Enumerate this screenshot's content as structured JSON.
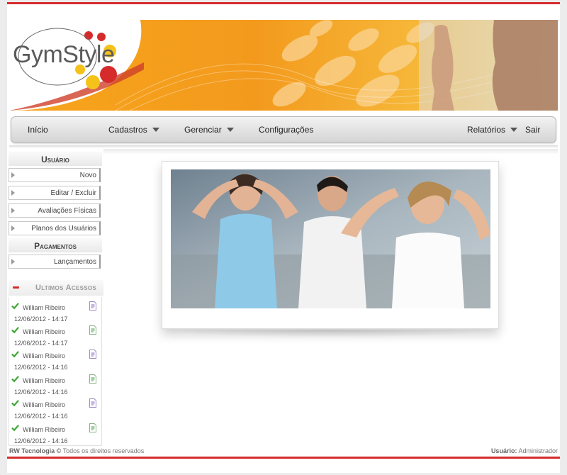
{
  "brand": {
    "logo_text": "GymStyle",
    "colors": {
      "accent_red": "#d62b2b",
      "orange": "#f39a1d",
      "yellow": "#f5c21a"
    }
  },
  "nav": {
    "home": "Início",
    "cadastros": "Cadastros",
    "gerenciar": "Gerenciar",
    "configuracoes": "Configurações",
    "relatorios": "Relatórios",
    "sair": "Sair"
  },
  "sidebar": {
    "usuario_header": "Usuário",
    "usuario_items": [
      {
        "label": "Novo"
      },
      {
        "label": "Editar / Excluir"
      },
      {
        "label": "Avaliações Físicas"
      },
      {
        "label": "Planos dos Usuários"
      }
    ],
    "pagamentos_header": "Pagamentos",
    "pagamentos_items": [
      {
        "label": "Lançamentos"
      }
    ]
  },
  "recent_access": {
    "title": "Ultimos Acessos",
    "entries": [
      {
        "name": "William Ribeiro",
        "time": "12/06/2012 - 14:17",
        "icon": "purple-doc-icon"
      },
      {
        "name": "William Ribeiro",
        "time": "12/06/2012 - 14:17",
        "icon": "green-doc-icon"
      },
      {
        "name": "William Ribeiro",
        "time": "12/06/2012 - 14:16",
        "icon": "purple-doc-icon"
      },
      {
        "name": "William Ribeiro",
        "time": "12/06/2012 - 14:16",
        "icon": "green-doc-icon"
      },
      {
        "name": "William Ribeiro",
        "time": "12/06/2012 - 14:16",
        "icon": "purple-doc-icon"
      },
      {
        "name": "William Ribeiro",
        "time": "12/06/2012 - 14:16",
        "icon": "green-doc-icon"
      }
    ]
  },
  "footer": {
    "company": "RW Tecnologia ©",
    "rights": "Todos os direitos reservados",
    "user_label": "Usuário:",
    "user_value": "Administrador"
  }
}
